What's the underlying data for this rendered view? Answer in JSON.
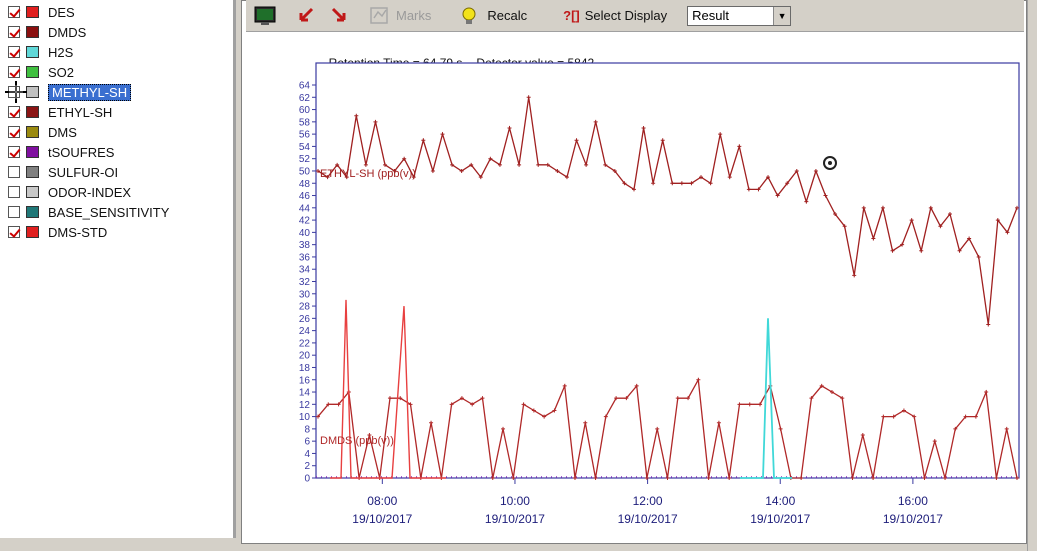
{
  "compounds": [
    {
      "name": "DES",
      "checked": true,
      "color": "#e02020",
      "selected": false
    },
    {
      "name": "DMDS",
      "checked": true,
      "color": "#8b1010",
      "selected": false
    },
    {
      "name": "H2S",
      "checked": true,
      "color": "#60d8d8",
      "selected": false
    },
    {
      "name": "SO2",
      "checked": true,
      "color": "#40c040",
      "selected": false
    },
    {
      "name": "METHYL-SH",
      "checked": false,
      "color": "#c0c0c0",
      "selected": true
    },
    {
      "name": "ETHYL-SH",
      "checked": true,
      "color": "#8b1515",
      "selected": false
    },
    {
      "name": "DMS",
      "checked": true,
      "color": "#9a8a10",
      "selected": false
    },
    {
      "name": "tSOUFRES",
      "checked": true,
      "color": "#8010a0",
      "selected": false
    },
    {
      "name": "SULFUR-OI",
      "checked": false,
      "color": "#808080",
      "selected": false
    },
    {
      "name": "ODOR-INDEX",
      "checked": false,
      "color": "#c8c8c8",
      "selected": false
    },
    {
      "name": "BASE_SENSITIVITY",
      "checked": false,
      "color": "#207878",
      "selected": false
    },
    {
      "name": "DMS-STD",
      "checked": true,
      "color": "#e02020",
      "selected": false
    }
  ],
  "toolbar": {
    "marks_label": "Marks",
    "recalc_label": "Recalc",
    "select_display_label": "Select Display",
    "select_display_icon": "?[]",
    "display_value": "Result"
  },
  "readout": {
    "retention_time": "Retention Time = 64.79 s",
    "detector_value": "Detector value = 5842"
  },
  "chart_data": {
    "type": "line",
    "x_tick_times": [
      "08:00",
      "10:00",
      "12:00",
      "14:00",
      "16:00"
    ],
    "x_tick_dates": [
      "19/10/2017",
      "19/10/2017",
      "19/10/2017",
      "19/10/2017",
      "19/10/2017"
    ],
    "x_hours": [
      7.0,
      9.0,
      11.0,
      13.0,
      15.0,
      17.2
    ],
    "ylim": [
      0,
      64
    ],
    "y_ticks": [
      "0",
      "2",
      "4",
      "6",
      "8",
      "10",
      "12",
      "14",
      "16",
      "18",
      "20",
      "22",
      "24",
      "26",
      "28",
      "30",
      "32",
      "34",
      "36",
      "38",
      "40",
      "42",
      "44",
      "46",
      "48",
      "50",
      "52",
      "54",
      "56",
      "58",
      "60",
      "62",
      "64"
    ],
    "series": [
      {
        "name": "ETHYL-SH (ppb(v))",
        "color": "#a02020",
        "values": [
          50,
          49,
          51,
          49,
          59,
          51,
          58,
          51,
          50,
          52,
          49,
          55,
          50,
          56,
          51,
          50,
          51,
          49,
          52,
          51,
          57,
          51,
          62,
          51,
          51,
          50,
          49,
          55,
          51,
          58,
          51,
          50,
          48,
          47,
          57,
          48,
          55,
          48,
          48,
          48,
          49,
          48,
          56,
          49,
          54,
          47,
          47,
          49,
          46,
          48,
          50,
          45,
          50,
          46,
          43,
          41,
          33,
          44,
          39,
          44,
          37,
          38,
          42,
          37,
          44,
          41,
          43,
          37,
          39,
          36,
          25,
          42,
          40,
          44
        ],
        "label_index": 0
      },
      {
        "name": "DMDS (ppb(v))",
        "color": "#b02828",
        "values": [
          10,
          12,
          12,
          14,
          0,
          7,
          0,
          13,
          13,
          12,
          0,
          9,
          0,
          12,
          13,
          12,
          13,
          0,
          8,
          0,
          12,
          11,
          10,
          11,
          15,
          0,
          9,
          0,
          10,
          13,
          13,
          15,
          0,
          8,
          0,
          13,
          13,
          16,
          0,
          9,
          0,
          12,
          12,
          12,
          15,
          8,
          0,
          0,
          13,
          15,
          14,
          13,
          0,
          7,
          0,
          10,
          10,
          11,
          10,
          0,
          6,
          0,
          8,
          10,
          10,
          14,
          0,
          8,
          0
        ],
        "label_index": 0
      },
      {
        "name": "",
        "color": "#e84040",
        "values": [
          0,
          0,
          0,
          29,
          0,
          0,
          0,
          0,
          0,
          0,
          0,
          0,
          28,
          0,
          0,
          0,
          0,
          0,
          0,
          0
        ],
        "spikes": true
      },
      {
        "name": "",
        "color": "#40d8d8",
        "values": [
          0,
          0,
          0,
          0,
          0,
          26,
          0,
          0,
          0,
          0
        ],
        "spikes": true
      }
    ]
  }
}
